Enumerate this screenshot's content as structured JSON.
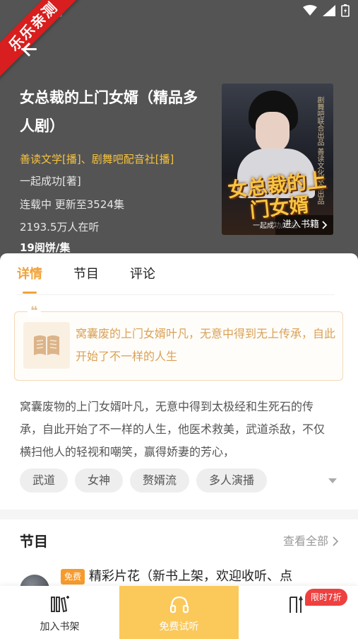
{
  "watermark": "乐乐亲测",
  "header": {
    "title": "女总裁的上门女婿（精品多人剧）",
    "narrators": "善读文学[播]、剧舞吧配音社[播]",
    "author": "一起成功[著]",
    "serial_status": "连载中  更新至3524集",
    "listeners": "2193.5万人在听",
    "price": "19阅饼/集"
  },
  "cover": {
    "title": "女总裁的上门女婿",
    "author_label": "一起成功/作品",
    "side_text": "剧舞吧联合出品 善读文化联合出品",
    "enter_label": "进入书籍"
  },
  "tabs": [
    {
      "label": "详情",
      "active": true
    },
    {
      "label": "节目",
      "active": false
    },
    {
      "label": "评论",
      "active": false
    }
  ],
  "summary": {
    "quote_mark": "❝",
    "short": "窝囊废的上门女婿叶凡，无意中得到无上传承，自此开始了不一样的人生",
    "full": "窝囊废物的上门女婿叶凡，无意中得到太极经和生死石的传承，自此开始了不一样的人生，他医术救美，武道杀敌，不仅横扫他人的轻视和嘲笑，赢得娇妻的芳心，"
  },
  "tags": [
    "武道",
    "女神",
    "赘婿流",
    "多人演播"
  ],
  "programs": {
    "title": "节目",
    "see_all": "查看全部",
    "first_episode": {
      "badge": "免费",
      "title": "精彩片花（新书上架，欢迎收听、点"
    }
  },
  "bottom_bar": {
    "shelf_label": "加入书架",
    "listen_label": "免费试听",
    "limit_badge": "限时7折"
  },
  "colors": {
    "accent": "#f0a33a",
    "narrator": "#f6c23e",
    "listen_bg": "#fbc85a",
    "badge_red": "#ef4040",
    "ribbon_red": "#d81e1e"
  }
}
